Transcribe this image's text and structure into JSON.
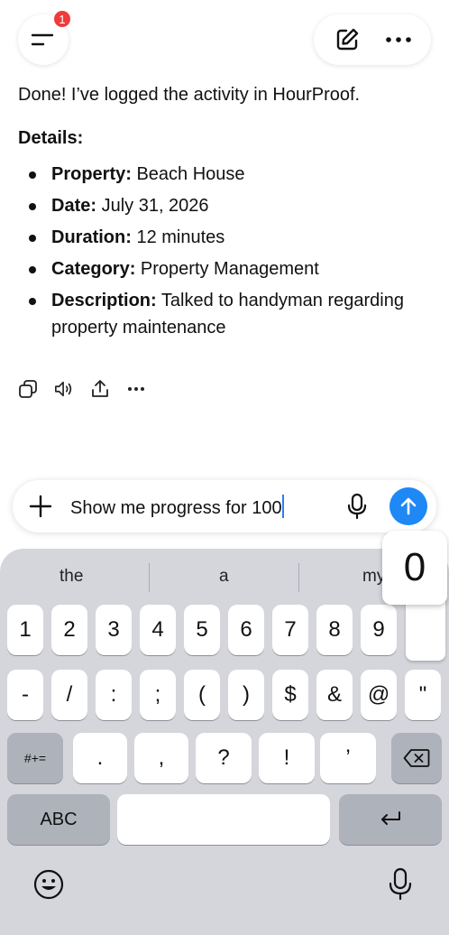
{
  "top_bar": {
    "notification_count": "1"
  },
  "message": {
    "intro": "Done! I’ve logged the activity in HourProof.",
    "details_title": "Details:",
    "details": [
      {
        "label": "Property:",
        "value": " Beach House"
      },
      {
        "label": "Date:",
        "value": " July 31, 2026"
      },
      {
        "label": "Duration:",
        "value": " 12 minutes"
      },
      {
        "label": "Category:",
        "value": " Property Management"
      },
      {
        "label": "Description:",
        "value": " Talked to handyman regarding property maintenance"
      }
    ]
  },
  "composer": {
    "text": "Show me progress for 100"
  },
  "keyboard": {
    "suggestions": [
      "the",
      "a",
      "my"
    ],
    "popup_key": "0",
    "row1": [
      "1",
      "2",
      "3",
      "4",
      "5",
      "6",
      "7",
      "8",
      "9"
    ],
    "row2": [
      "-",
      "/",
      ":",
      ";",
      "(",
      ")",
      "$",
      "&",
      "@",
      "\""
    ],
    "row3": [
      ".",
      ",",
      "?",
      "!",
      "’"
    ],
    "symbols_key": "#+=",
    "abc_key": "ABC"
  },
  "colors": {
    "send_button": "#1e88f5",
    "badge": "#ef3b3b",
    "keyboard_bg": "#d5d6dc",
    "caret": "#2f7ff0"
  }
}
